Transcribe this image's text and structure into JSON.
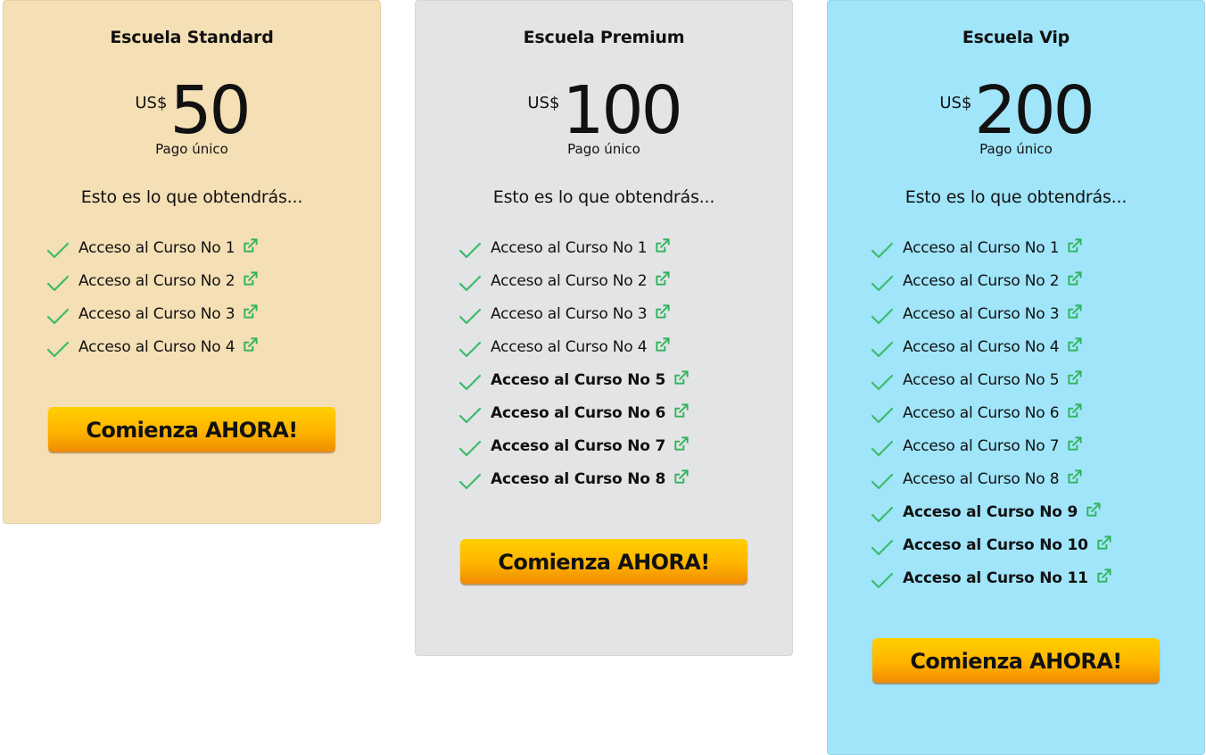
{
  "plans": [
    {
      "title": "Escuela Standard",
      "currency": "US$",
      "price": "50",
      "payment_note": "Pago único",
      "intro": "Esto es lo que obtendrás...",
      "features": [
        {
          "label": "Acceso al Curso No 1",
          "bold": false
        },
        {
          "label": "Acceso al Curso No 2",
          "bold": false
        },
        {
          "label": "Acceso al Curso No 3",
          "bold": false
        },
        {
          "label": "Acceso al Curso No 4",
          "bold": false
        }
      ],
      "cta_label": "Comienza AHORA!",
      "background": "#f5dfb5"
    },
    {
      "title": "Escuela Premium",
      "currency": "US$",
      "price": "100",
      "payment_note": "Pago único",
      "intro": "Esto es lo que obtendrás...",
      "features": [
        {
          "label": "Acceso al Curso No 1",
          "bold": false
        },
        {
          "label": "Acceso al Curso No 2",
          "bold": false
        },
        {
          "label": "Acceso al Curso No 3",
          "bold": false
        },
        {
          "label": "Acceso al Curso No 4",
          "bold": false
        },
        {
          "label": "Acceso al Curso No 5",
          "bold": true
        },
        {
          "label": "Acceso al Curso No 6",
          "bold": true
        },
        {
          "label": "Acceso al Curso No 7",
          "bold": true
        },
        {
          "label": "Acceso al Curso No 8",
          "bold": true
        }
      ],
      "cta_label": "Comienza AHORA!",
      "background": "#e3e4e6"
    },
    {
      "title": "Escuela Vip",
      "currency": "US$",
      "price": "200",
      "payment_note": "Pago único",
      "intro": "Esto es lo que obtendrás...",
      "features": [
        {
          "label": "Acceso al Curso No 1",
          "bold": false
        },
        {
          "label": "Acceso al Curso No 2",
          "bold": false
        },
        {
          "label": "Acceso al Curso No 3",
          "bold": false
        },
        {
          "label": "Acceso al Curso No 4",
          "bold": false
        },
        {
          "label": "Acceso al Curso No 5",
          "bold": false
        },
        {
          "label": "Acceso al Curso No 6",
          "bold": false
        },
        {
          "label": "Acceso al Curso No 7",
          "bold": false
        },
        {
          "label": "Acceso al Curso No 8",
          "bold": false
        },
        {
          "label": "Acceso al Curso No 9",
          "bold": true
        },
        {
          "label": "Acceso al Curso No 10",
          "bold": true
        },
        {
          "label": "Acceso al Curso No 11",
          "bold": true
        }
      ],
      "cta_label": "Comienza AHORA!",
      "background": "#a0e5fa"
    }
  ],
  "icons": {
    "check": "check-icon",
    "link": "external-link-icon"
  },
  "colors": {
    "check": "#3dbb6b",
    "link": "#2fb35a",
    "cta_top": "#ffd000",
    "cta_bottom": "#f08c00"
  }
}
